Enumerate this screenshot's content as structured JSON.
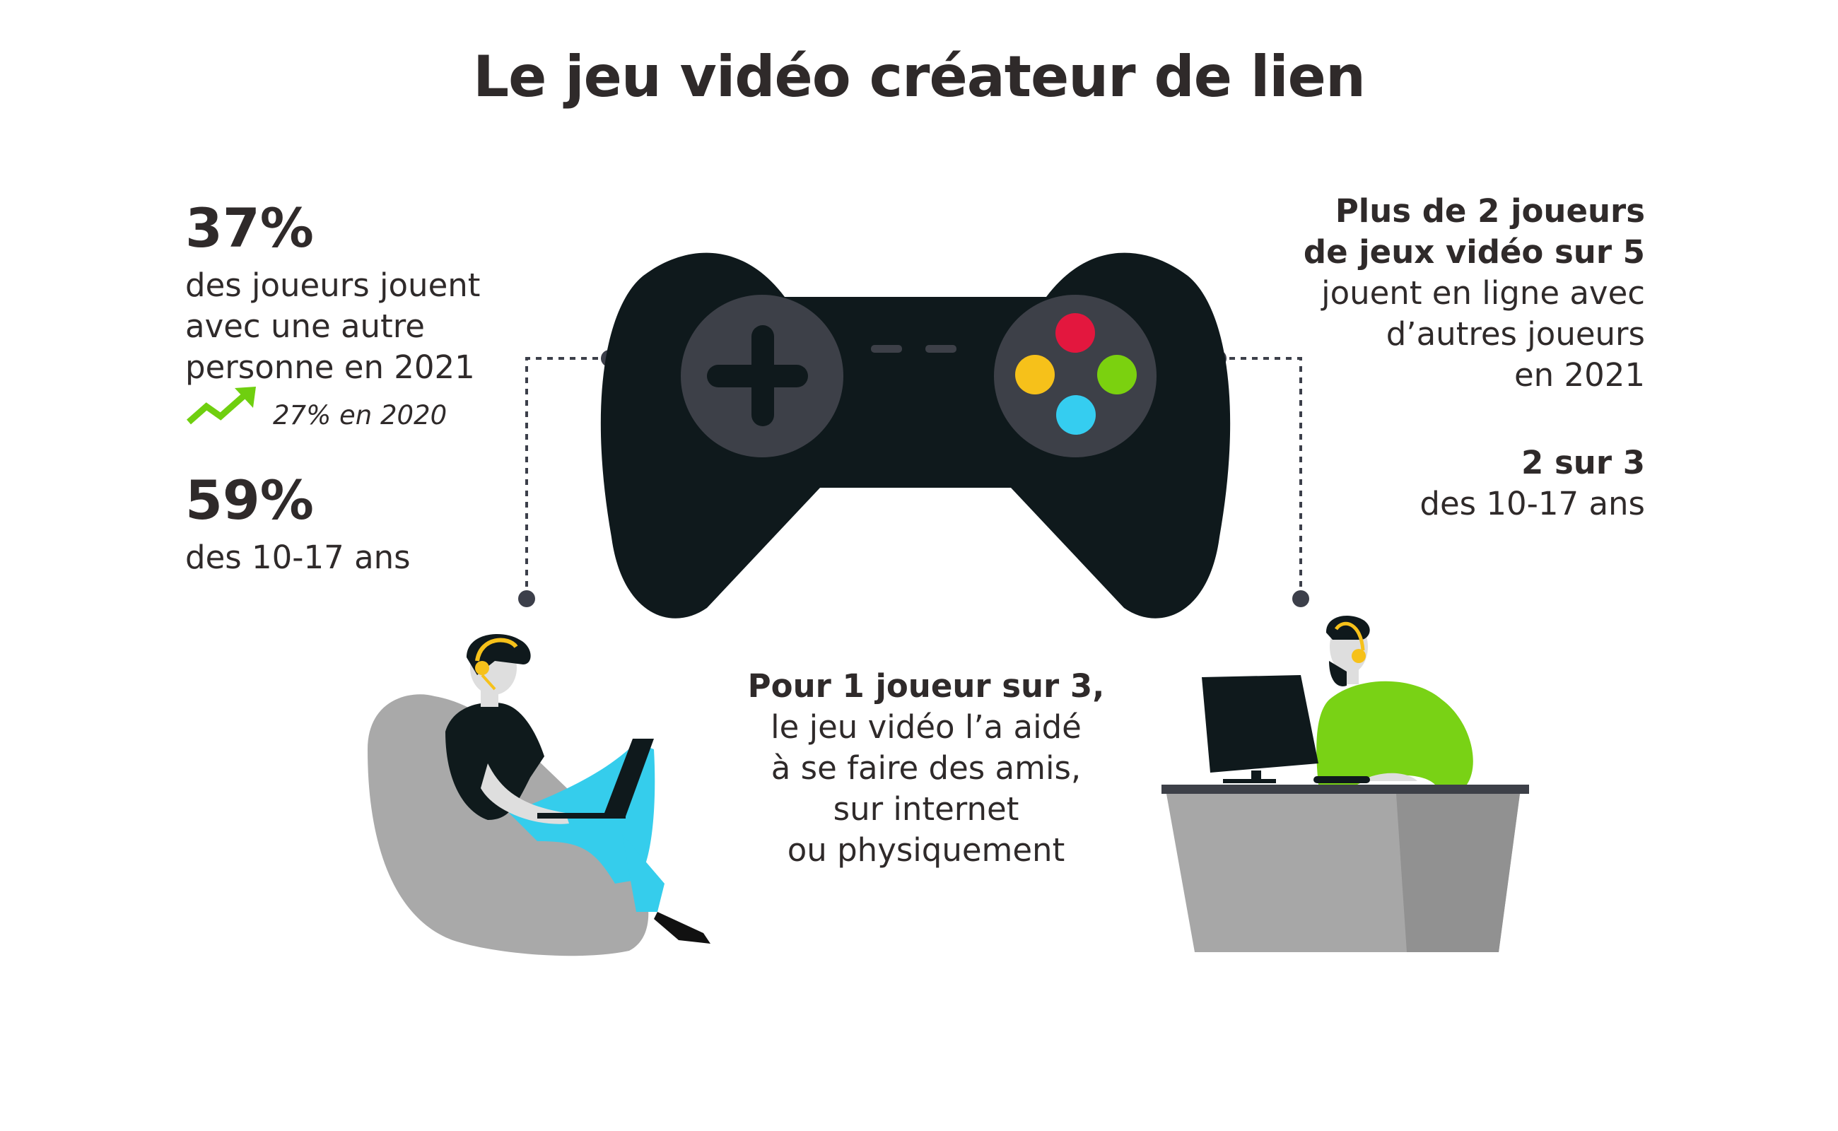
{
  "title": "Le jeu vidéo créateur de lien",
  "left": {
    "stat1_value": "37%",
    "stat1_lines": [
      "des joueurs jouent",
      "avec une autre",
      "personne en 2021"
    ],
    "trend_label": "27% en 2020",
    "stat2_value": "59%",
    "stat2_line": "des 10-17 ans"
  },
  "right": {
    "bold_lines": [
      "Plus de 2 joueurs",
      "de jeux vidéo sur 5"
    ],
    "lines": [
      "jouent en ligne avec",
      "d’autres joueurs",
      "en 2021"
    ],
    "stat_bold": "2 sur 3",
    "stat_line": "des 10-17 ans"
  },
  "center": {
    "bold_line": "Pour 1 joueur sur 3,",
    "lines": [
      "le jeu vidéo l’a aidé",
      "à se faire des amis,",
      "sur internet",
      "ou physiquement"
    ]
  },
  "colors": {
    "controller": "#0f191c",
    "pad": "#3d4048",
    "button_red": "#e3173e",
    "button_yellow": "#f6c11a",
    "button_green": "#7bd10f",
    "button_blue": "#35cdf0",
    "trend_arrow": "#6fcf0f",
    "shirt_green": "#79d215",
    "pants_blue": "#35cdec",
    "beanbag": "#a9a9a9",
    "desk": "#a7a7a7"
  },
  "icons": [
    "gamepad-icon",
    "trend-up-arrow-icon",
    "gamer-on-beanbag-illustration",
    "gamer-at-desk-illustration"
  ]
}
